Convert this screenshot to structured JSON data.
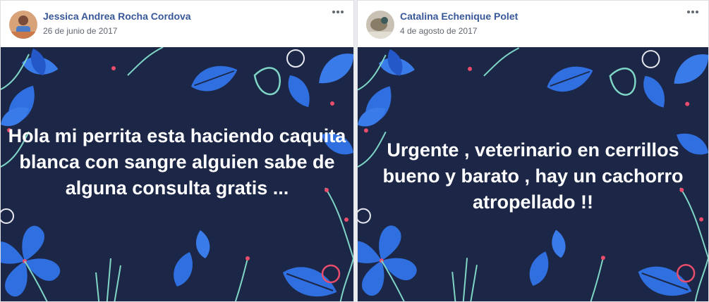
{
  "posts": [
    {
      "author": "Jessica Andrea Rocha Cordova",
      "date": "26 de junio de 2017",
      "text": "Hola mi perrita esta haciendo caquita blanca con sangre alguien sabe de alguna consulta gratis ...",
      "more_icon": "more-horizontal-icon",
      "colors": {
        "background": "#1c2747",
        "text": "#ffffff"
      }
    },
    {
      "author": "Catalina Echenique Polet",
      "date": "4 de agosto de 2017",
      "text": "Urgente , veterinario en cerrillos bueno y barato , hay un cachorro atropellado !!",
      "more_icon": "more-horizontal-icon",
      "colors": {
        "background": "#1c2747",
        "text": "#ffffff"
      }
    }
  ],
  "colors": {
    "author_link": "#385898",
    "date": "#616770",
    "leaf_blue": "#2f6fe0",
    "leaf_outline": "#7fd6c6",
    "accent_pink": "#ea4c6b"
  }
}
